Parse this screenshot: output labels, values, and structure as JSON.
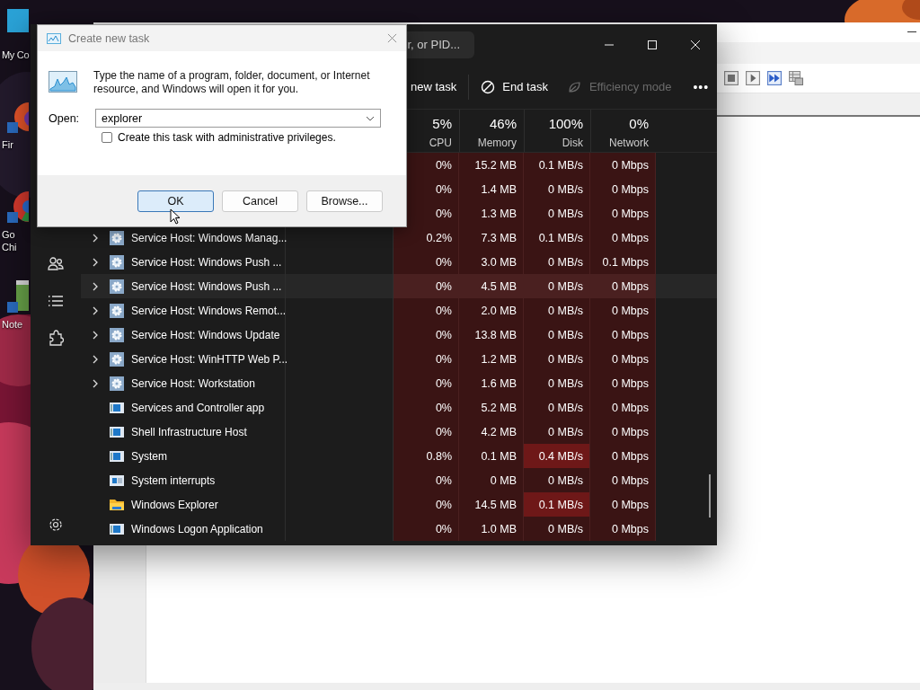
{
  "desktop": {
    "icons": [
      {
        "kind": "computer",
        "label": "My Co"
      },
      {
        "kind": "fox",
        "label": "Fir"
      },
      {
        "kind": "chrome",
        "label": "Go Chi"
      },
      {
        "kind": "notepad",
        "label": "Note"
      }
    ]
  },
  "task_manager": {
    "search": {
      "placeholder": "r, or PID..."
    },
    "toolbar": [
      {
        "kind": "text",
        "label": "new task",
        "disabled": false
      },
      {
        "kind": "end",
        "label": "End task",
        "disabled": false
      },
      {
        "kind": "leaf",
        "label": "Efficiency mode",
        "disabled": true
      },
      {
        "kind": "more",
        "label": "•••",
        "disabled": false
      }
    ],
    "nav_items": [
      {
        "kind": "users"
      },
      {
        "kind": "list"
      },
      {
        "kind": "puzzle"
      },
      {
        "kind": "settings"
      }
    ],
    "columns": [
      {
        "percent": "5%",
        "label": "CPU"
      },
      {
        "percent": "46%",
        "label": "Memory"
      },
      {
        "percent": "100%",
        "label": "Disk"
      },
      {
        "percent": "0%",
        "label": "Network"
      }
    ],
    "rows": [
      {
        "hovered": false,
        "cpu": "0%",
        "memory": "15.2 MB",
        "disk": "0.1 MB/s",
        "network": "0 Mbps",
        "disk_hot": false
      },
      {
        "hovered": false,
        "cpu": "0%",
        "memory": "1.4 MB",
        "disk": "0 MB/s",
        "network": "0 Mbps",
        "disk_hot": false
      },
      {
        "hovered": false,
        "cpu": "0%",
        "memory": "1.3 MB",
        "disk": "0 MB/s",
        "network": "0 Mbps",
        "disk_hot": false
      },
      {
        "name": "Service Host: Windows Manag...",
        "kind": "service",
        "expandable": true,
        "hovered": false,
        "cpu": "0.2%",
        "memory": "7.3 MB",
        "disk": "0.1 MB/s",
        "network": "0 Mbps",
        "disk_hot": false
      },
      {
        "name": "Service Host: Windows Push ...",
        "kind": "service",
        "expandable": true,
        "hovered": false,
        "cpu": "0%",
        "memory": "3.0 MB",
        "disk": "0 MB/s",
        "network": "0.1 Mbps",
        "disk_hot": false
      },
      {
        "name": "Service Host: Windows Push ...",
        "kind": "service",
        "expandable": true,
        "hovered": true,
        "cpu": "0%",
        "memory": "4.5 MB",
        "disk": "0 MB/s",
        "network": "0 Mbps",
        "disk_hot": false
      },
      {
        "name": "Service Host: Windows Remot...",
        "kind": "service",
        "expandable": true,
        "hovered": false,
        "cpu": "0%",
        "memory": "2.0 MB",
        "disk": "0 MB/s",
        "network": "0 Mbps",
        "disk_hot": false
      },
      {
        "name": "Service Host: Windows Update",
        "kind": "service",
        "expandable": true,
        "hovered": false,
        "cpu": "0%",
        "memory": "13.8 MB",
        "disk": "0 MB/s",
        "network": "0 Mbps",
        "disk_hot": false
      },
      {
        "name": "Service Host: WinHTTP Web P...",
        "kind": "service",
        "expandable": true,
        "hovered": false,
        "cpu": "0%",
        "memory": "1.2 MB",
        "disk": "0 MB/s",
        "network": "0 Mbps",
        "disk_hot": false
      },
      {
        "name": "Service Host: Workstation",
        "kind": "service",
        "expandable": true,
        "hovered": false,
        "cpu": "0%",
        "memory": "1.6 MB",
        "disk": "0 MB/s",
        "network": "0 Mbps",
        "disk_hot": false
      },
      {
        "name": "Services and Controller app",
        "kind": "app",
        "expandable": false,
        "hovered": false,
        "cpu": "0%",
        "memory": "5.2 MB",
        "disk": "0 MB/s",
        "network": "0 Mbps",
        "disk_hot": false
      },
      {
        "name": "Shell Infrastructure Host",
        "kind": "app",
        "expandable": false,
        "hovered": false,
        "cpu": "0%",
        "memory": "4.2 MB",
        "disk": "0 MB/s",
        "network": "0 Mbps",
        "disk_hot": false
      },
      {
        "name": "System",
        "kind": "app",
        "expandable": false,
        "hovered": false,
        "cpu": "0.8%",
        "memory": "0.1 MB",
        "disk": "0.4 MB/s",
        "network": "0 Mbps",
        "disk_hot": true
      },
      {
        "name": "System interrupts",
        "kind": "interrupts",
        "expandable": false,
        "hovered": false,
        "cpu": "0%",
        "memory": "0 MB",
        "disk": "0 MB/s",
        "network": "0 Mbps",
        "disk_hot": false
      },
      {
        "name": "Windows Explorer",
        "kind": "folder",
        "expandable": false,
        "hovered": false,
        "cpu": "0%",
        "memory": "14.5 MB",
        "disk": "0.1 MB/s",
        "network": "0 Mbps",
        "disk_hot": true
      },
      {
        "name": "Windows Logon Application",
        "kind": "app",
        "expandable": false,
        "hovered": false,
        "cpu": "0%",
        "memory": "1.0 MB",
        "disk": "0 MB/s",
        "network": "0 Mbps",
        "disk_hot": false
      }
    ]
  },
  "dialog": {
    "title": "Create new task",
    "message": "Type the name of a program, folder, document, or Internet resource, and Windows will open it for you.",
    "open_label": "Open:",
    "open_value": "explorer",
    "admin_checkbox": {
      "label": "Create this task with administrative privileges.",
      "checked": false
    },
    "buttons": [
      {
        "label": "OK",
        "selected": true
      },
      {
        "label": "Cancel",
        "selected": false
      },
      {
        "label": "Browse...",
        "selected": false
      }
    ]
  }
}
